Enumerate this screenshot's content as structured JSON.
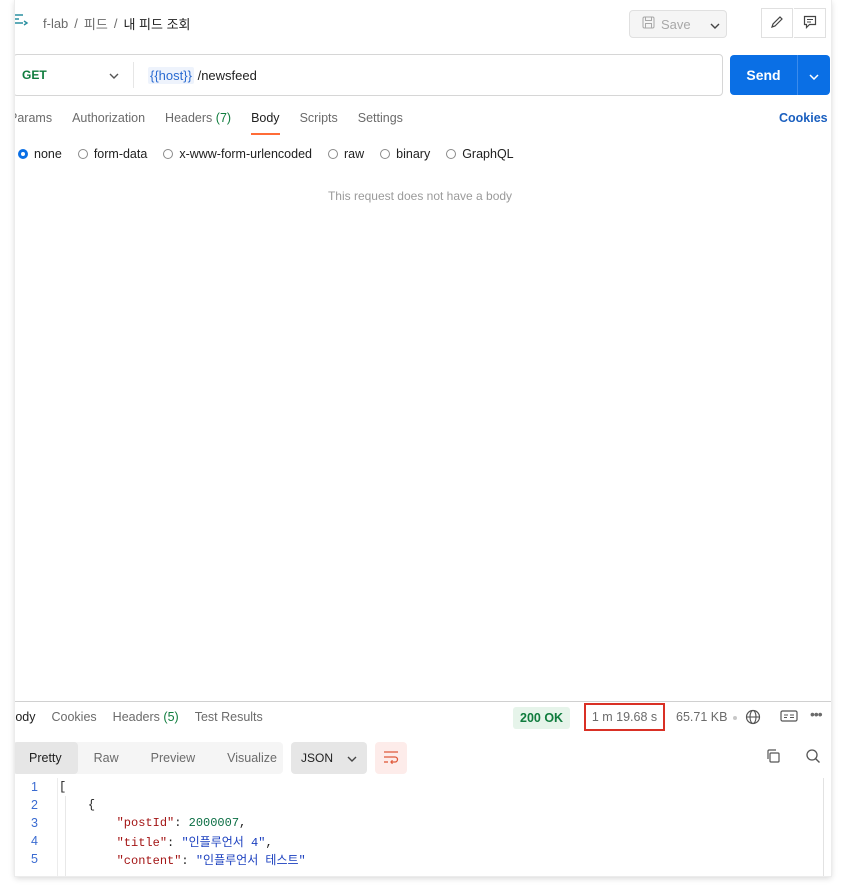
{
  "breadcrumb": {
    "collection": "f-lab",
    "folder": "피드",
    "request": "내 피드 조회",
    "separator": "/"
  },
  "toolbar": {
    "save_label": "Save"
  },
  "request": {
    "method": "GET",
    "url_var": "{{host}}",
    "url_path": "/newsfeed",
    "send_label": "Send"
  },
  "request_tabs": [
    {
      "label": "Params",
      "count": ""
    },
    {
      "label": "Authorization",
      "count": ""
    },
    {
      "label": "Headers",
      "count": "(7)"
    },
    {
      "label": "Body",
      "count": "",
      "active": true
    },
    {
      "label": "Scripts",
      "count": ""
    },
    {
      "label": "Settings",
      "count": ""
    }
  ],
  "cookies_link": "Cookies",
  "body_types": [
    {
      "label": "none",
      "selected": true
    },
    {
      "label": "form-data",
      "selected": false
    },
    {
      "label": "x-www-form-urlencoded",
      "selected": false
    },
    {
      "label": "raw",
      "selected": false
    },
    {
      "label": "binary",
      "selected": false
    },
    {
      "label": "GraphQL",
      "selected": false
    }
  ],
  "body_empty_message": "This request does not have a body",
  "response": {
    "tabs": [
      {
        "label": "Body",
        "count": ""
      },
      {
        "label": "Cookies",
        "count": ""
      },
      {
        "label": "Headers",
        "count": "(5)"
      },
      {
        "label": "Test Results",
        "count": ""
      }
    ],
    "status": "200 OK",
    "time": "1 m 19.68 s",
    "size": "65.71 KB",
    "views": [
      "Pretty",
      "Raw",
      "Preview",
      "Visualize"
    ],
    "active_view": "Pretty",
    "format": "JSON",
    "lines": [
      {
        "n": "1",
        "indent": 0,
        "parts": [
          [
            "p",
            "["
          ]
        ]
      },
      {
        "n": "2",
        "indent": 1,
        "parts": [
          [
            "p",
            "{"
          ]
        ]
      },
      {
        "n": "3",
        "indent": 2,
        "parts": [
          [
            "k",
            "\"postId\""
          ],
          [
            "p",
            ": "
          ],
          [
            "n",
            "2000007"
          ],
          [
            "p",
            ","
          ]
        ]
      },
      {
        "n": "4",
        "indent": 2,
        "parts": [
          [
            "k",
            "\"title\""
          ],
          [
            "p",
            ": "
          ],
          [
            "s",
            "\"인플루언서 4\""
          ],
          [
            "p",
            ","
          ]
        ]
      },
      {
        "n": "5",
        "indent": 2,
        "parts": [
          [
            "k",
            "\"content\""
          ],
          [
            "p",
            ": "
          ],
          [
            "s",
            "\"인플루언서 테스트\""
          ]
        ]
      }
    ]
  },
  "colors": {
    "accent": "#ff6c37",
    "send": "#0a6fe5",
    "status_ok": "#0f7c3d",
    "highlight_box": "#d93025"
  }
}
